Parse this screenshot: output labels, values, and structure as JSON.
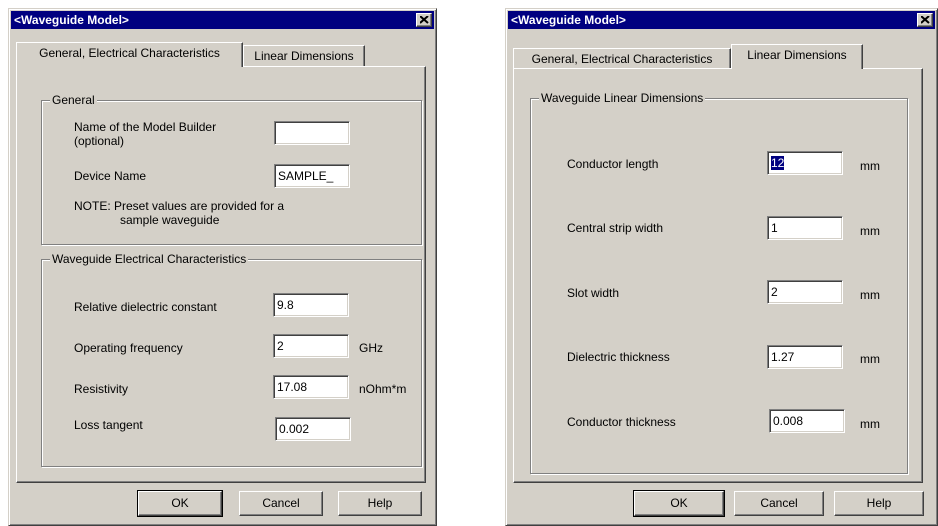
{
  "dialog_left": {
    "title": "<Waveguide Model>",
    "tabs": [
      "General, Electrical Characteristics",
      "Linear Dimensions"
    ],
    "active_tab": 0,
    "general": {
      "title": "General",
      "model_builder_label_line1": "Name of the Model Builder",
      "model_builder_label_line2": "(optional)",
      "model_builder_value": "",
      "device_name_label": "Device Name",
      "device_name_value": "SAMPLE_",
      "note_line1": "NOTE: Preset values are provided for a",
      "note_line2": "sample waveguide"
    },
    "electrical": {
      "title": "Waveguide Electrical Characteristics",
      "fields": [
        {
          "label": "Relative dielectric constant",
          "value": "9.8",
          "unit": ""
        },
        {
          "label": "Operating frequency",
          "value": "2",
          "unit": "GHz"
        },
        {
          "label": "Resistivity",
          "value": "17.08",
          "unit": "nOhm*m"
        },
        {
          "label": "Loss tangent",
          "value": "0.002",
          "unit": ""
        }
      ]
    },
    "buttons": {
      "ok": "OK",
      "cancel": "Cancel",
      "help": "Help"
    }
  },
  "dialog_right": {
    "title": "<Waveguide Model>",
    "tabs": [
      "General, Electrical Characteristics",
      "Linear Dimensions"
    ],
    "active_tab": 1,
    "linear": {
      "title": "Waveguide Linear Dimensions",
      "fields": [
        {
          "label": "Conductor length",
          "value": "12",
          "unit": "mm"
        },
        {
          "label": "Central strip width",
          "value": "1",
          "unit": "mm"
        },
        {
          "label": "Slot width",
          "value": "2",
          "unit": "mm"
        },
        {
          "label": "Dielectric thickness",
          "value": "1.27",
          "unit": "mm"
        },
        {
          "label": "Conductor thickness",
          "value": "0.008",
          "unit": "mm"
        }
      ]
    },
    "buttons": {
      "ok": "OK",
      "cancel": "Cancel",
      "help": "Help"
    }
  },
  "colors": {
    "titlebar": "#000080",
    "face": "#d4d0c8",
    "selection": "#000080"
  }
}
